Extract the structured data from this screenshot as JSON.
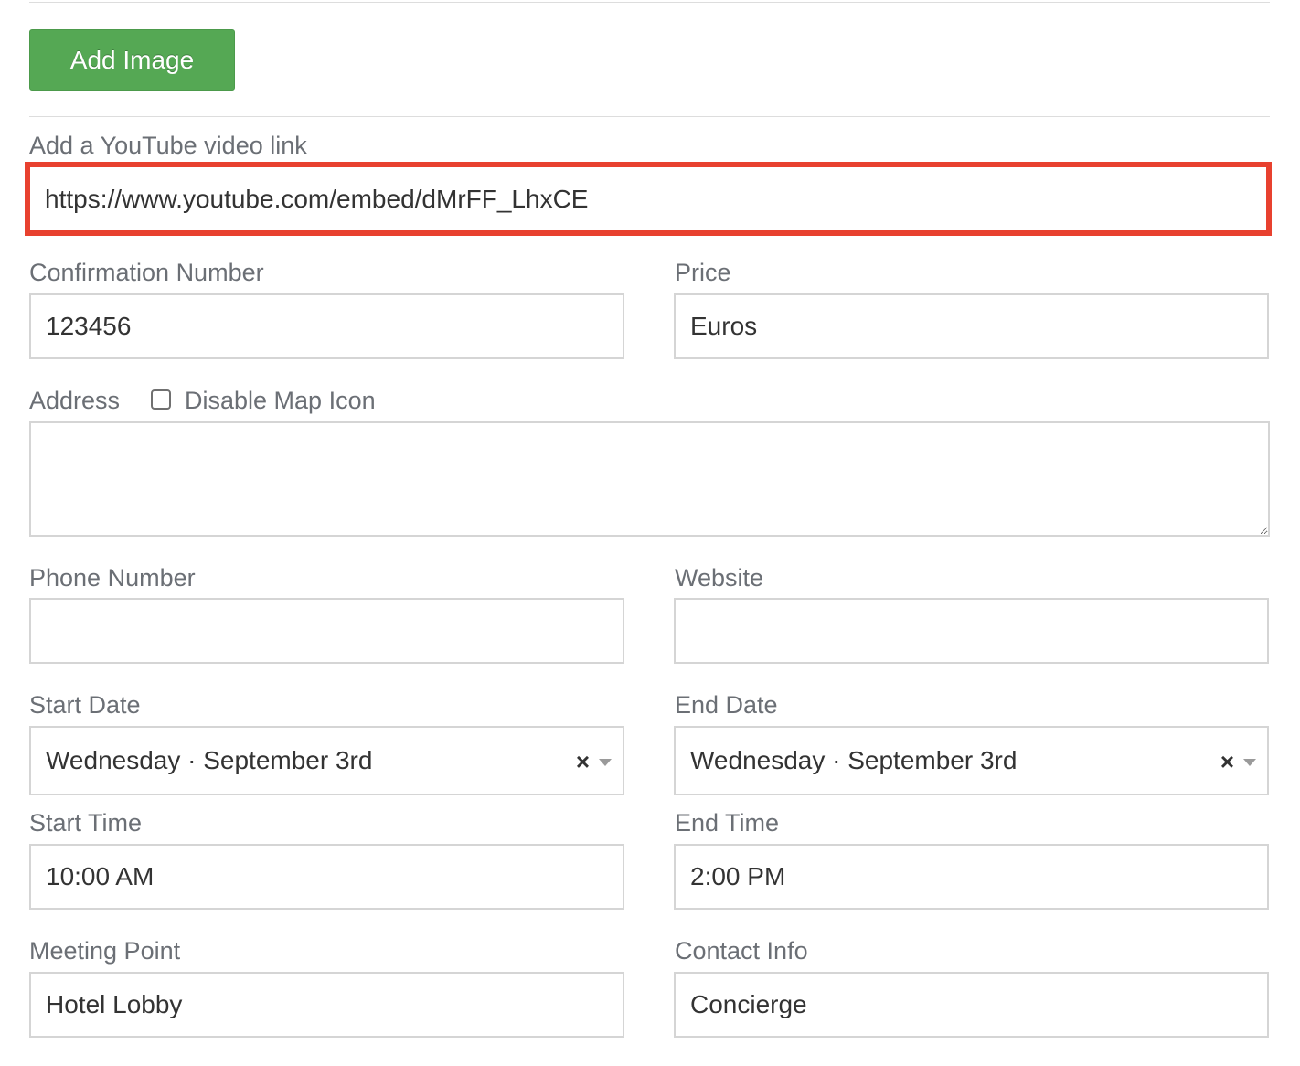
{
  "buttons": {
    "add_image": "Add Image"
  },
  "youtube": {
    "label": "Add a YouTube video link",
    "value": "https://www.youtube.com/embed/dMrFF_LhxCE"
  },
  "confirmation": {
    "label": "Confirmation Number",
    "value": "123456"
  },
  "price": {
    "label": "Price",
    "value": "Euros"
  },
  "address": {
    "label": "Address",
    "checkbox_label": "Disable Map Icon",
    "checkbox_checked": false,
    "value": ""
  },
  "phone": {
    "label": "Phone Number",
    "value": ""
  },
  "website": {
    "label": "Website",
    "value": ""
  },
  "start_date": {
    "label": "Start Date",
    "value": "Wednesday · September 3rd",
    "clear_icon": "×"
  },
  "end_date": {
    "label": "End Date",
    "value": "Wednesday · September 3rd",
    "clear_icon": "×"
  },
  "start_time": {
    "label": "Start Time",
    "value": "10:00 AM"
  },
  "end_time": {
    "label": "End Time",
    "value": "2:00 PM"
  },
  "meeting_point": {
    "label": "Meeting Point",
    "value": "Hotel Lobby"
  },
  "contact_info": {
    "label": "Contact Info",
    "value": "Concierge"
  },
  "colors": {
    "button_green": "#55a854",
    "highlight_red": "#e8412f",
    "label_gray": "#6b6f75",
    "border_gray": "#d5d5d5"
  }
}
